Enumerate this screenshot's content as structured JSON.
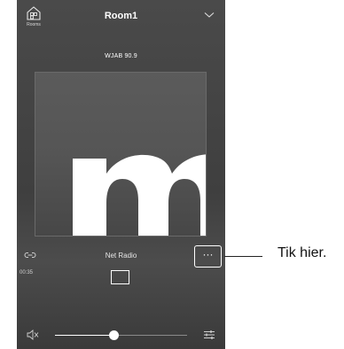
{
  "header": {
    "rooms_label": "Rooms",
    "room_name": "Room1"
  },
  "now_playing": {
    "station": "WJAB 90.9",
    "source": "Net Radio",
    "elapsed": "00:35",
    "more_label": "···"
  },
  "volume": {
    "level": 0.44
  },
  "annotation": {
    "text": "Tik hier."
  },
  "colors": {
    "background": "#424242",
    "foreground": "#ffffff"
  },
  "icons": [
    "rooms-house-icon",
    "chevron-down-icon",
    "link-icon",
    "more-icon",
    "stop-icon",
    "mute-icon",
    "equalizer-icon"
  ]
}
